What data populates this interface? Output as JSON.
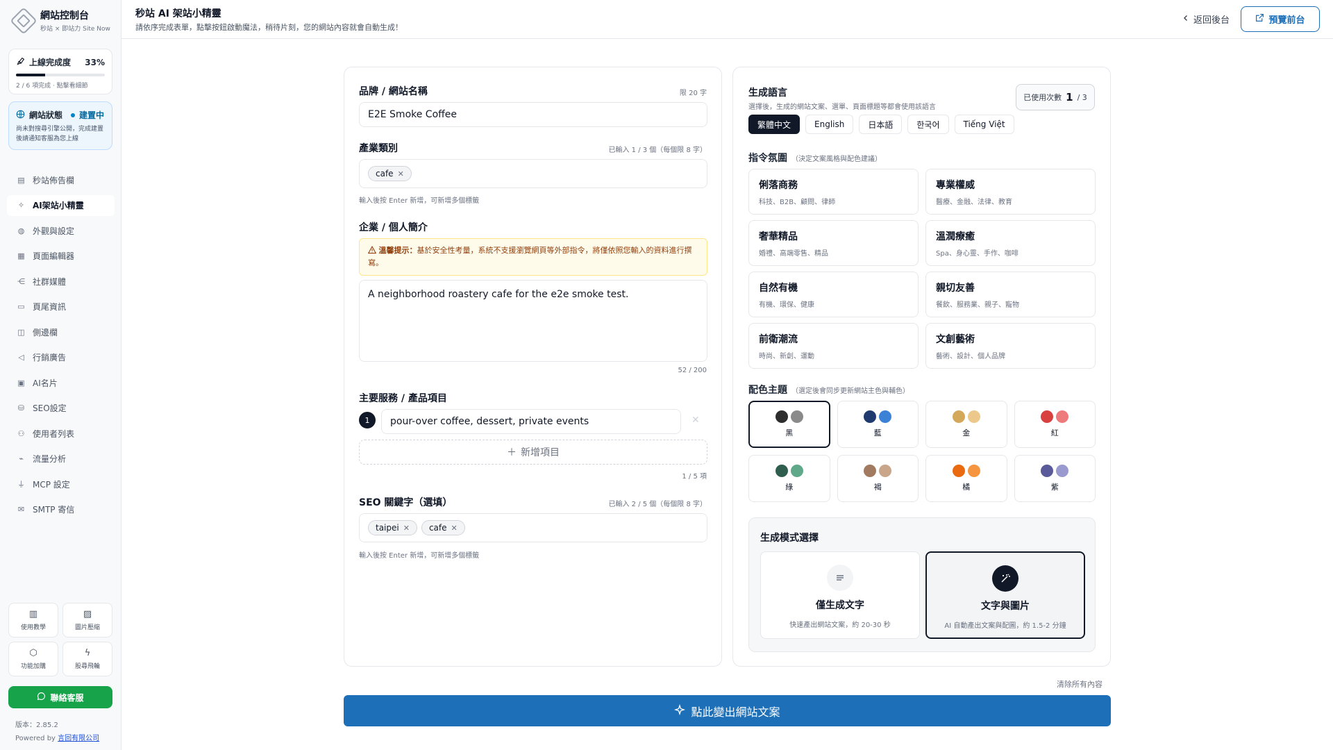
{
  "sidebar": {
    "brand": {
      "title": "網站控制台",
      "subtitle": "秒站 × 即站力 Site Now"
    },
    "progress": {
      "label": "上線完成度",
      "percent_text": "33%",
      "fraction": 0.33,
      "note": "2 / 6 項完成 · 點擊看細節"
    },
    "site_status": {
      "label": "網站狀態",
      "value": "建置中",
      "note": "尚未對搜尋引擎公開，完成建置後請通知客服為您上線"
    },
    "nav": [
      {
        "label": "秒站佈告欄",
        "icon": "bulletin-icon",
        "active": false
      },
      {
        "label": "AI架站小精靈",
        "icon": "sparkle-icon",
        "active": true
      },
      {
        "label": "外觀與設定",
        "icon": "palette-icon",
        "active": false
      },
      {
        "label": "頁面編輯器",
        "icon": "layout-icon",
        "active": false
      },
      {
        "label": "社群媒體",
        "icon": "share-icon",
        "active": false
      },
      {
        "label": "頁尾資訊",
        "icon": "footer-icon",
        "active": false
      },
      {
        "label": "側邊欄",
        "icon": "sidebar-icon",
        "active": false
      },
      {
        "label": "行銷廣告",
        "icon": "megaphone-icon",
        "active": false
      },
      {
        "label": "AI名片",
        "icon": "card-icon",
        "active": false
      },
      {
        "label": "SEO設定",
        "icon": "database-icon",
        "active": false
      },
      {
        "label": "使用者列表",
        "icon": "users-icon",
        "active": false
      },
      {
        "label": "流量分析",
        "icon": "chart-icon",
        "active": false
      },
      {
        "label": "MCP 設定",
        "icon": "plug-icon",
        "active": false
      },
      {
        "label": "SMTP 寄信",
        "icon": "mail-icon",
        "active": false
      }
    ],
    "tools": [
      {
        "label": "使用教學",
        "icon": "book-icon"
      },
      {
        "label": "圖片壓縮",
        "icon": "image-icon"
      },
      {
        "label": "功能加購",
        "icon": "package-icon"
      },
      {
        "label": "股尋飛輪",
        "icon": "bolt-icon"
      }
    ],
    "contact_label": "聯絡客服",
    "version": "版本：2.85.2",
    "powered_prefix": "Powered by ",
    "powered_link": "言回有限公司"
  },
  "header": {
    "title": "秒站 AI 架站小精靈",
    "subtitle": "請依序完成表單，點擊按鈕啟動魔法，稍待片刻，您的網站內容就會自動生成！",
    "back_label": "返回後台",
    "preview_label": "預覽前台"
  },
  "form": {
    "brand_name": {
      "label": "品牌 / 網站名稱",
      "hint": "限 20 字",
      "value": "E2E Smoke Coffee"
    },
    "industry": {
      "label": "產業類別",
      "hint": "已輸入 1 / 3 個（每個限 8 字）",
      "tags": [
        "cafe"
      ],
      "help": "輸入後按 Enter 新增，可新增多個標籤"
    },
    "intro": {
      "label": "企業 / 個人簡介",
      "warn_title": "溫馨提示：",
      "warn_text": "基於安全性考量，系統不支援瀏覽網頁等外部指令，將僅依照您輸入的資料進行撰寫。",
      "value": "A neighborhood roastery cafe for the e2e smoke test.",
      "count": "52 / 200"
    },
    "services": {
      "label": "主要服務 / 產品項目",
      "items": [
        {
          "num": "1",
          "value": "pour-over coffee, dessert, private events"
        }
      ],
      "add_label": "新增項目",
      "count": "1 / 5 項"
    },
    "seo": {
      "label": "SEO 關鍵字（選填）",
      "hint": "已輸入 2 / 5 個（每個限 8 字）",
      "tags": [
        "taipei",
        "cafe"
      ],
      "help": "輸入後按 Enter 新增，可新增多個標籤"
    }
  },
  "generation": {
    "language": {
      "label": "生成語言",
      "desc": "選擇後，生成的網站文案、選單、頁面標題等都會使用該語言",
      "options": [
        "繁體中文",
        "English",
        "日本語",
        "한국어",
        "Tiếng Việt"
      ],
      "selected": "繁體中文"
    },
    "usage": {
      "label": "已使用次數",
      "used": "1",
      "total": "/ 3"
    },
    "mood": {
      "label": "指令氛圍",
      "note": "（決定文案風格與配色建議）",
      "options": [
        {
          "title": "俐落商務",
          "desc": "科技、B2B、顧問、律師"
        },
        {
          "title": "專業權威",
          "desc": "醫療、金融、法律、教育"
        },
        {
          "title": "奢華精品",
          "desc": "婚禮、高端零售、精品"
        },
        {
          "title": "溫潤療癒",
          "desc": "Spa、身心靈、手作、咖啡"
        },
        {
          "title": "自然有機",
          "desc": "有機、環保、健康"
        },
        {
          "title": "親切友善",
          "desc": "餐飲、服務業、親子、寵物"
        },
        {
          "title": "前衛潮流",
          "desc": "時尚、新創、運動"
        },
        {
          "title": "文創藝術",
          "desc": "藝術、設計、個人品牌"
        }
      ]
    },
    "palette": {
      "label": "配色主題",
      "note": "（選定後會同步更新網站主色與輔色）",
      "selected": "黑",
      "options": [
        {
          "name": "黑",
          "c1": "#2d2d2d",
          "c2": "#8a8a8a"
        },
        {
          "name": "藍",
          "c1": "#1e3a6e",
          "c2": "#3b82d6"
        },
        {
          "name": "金",
          "c1": "#d4a85a",
          "c2": "#ecc98a"
        },
        {
          "name": "紅",
          "c1": "#d94040",
          "c2": "#ee7b7b"
        },
        {
          "name": "綠",
          "c1": "#2f5e4e",
          "c2": "#5fa88a"
        },
        {
          "name": "褐",
          "c1": "#a17a60",
          "c2": "#c9a58a"
        },
        {
          "name": "橘",
          "c1": "#ea6a10",
          "c2": "#f59540"
        },
        {
          "name": "紫",
          "c1": "#5a5a9a",
          "c2": "#9a9ad0"
        }
      ]
    },
    "mode": {
      "label": "生成模式選擇",
      "selected": "文字與圖片",
      "options": [
        {
          "title": "僅生成文字",
          "desc": "快速產出網站文案，約 20-30 秒",
          "icon": "text-lines-icon"
        },
        {
          "title": "文字與圖片",
          "desc": "AI 自動產出文案與配圖，約 1.5-2 分鐘",
          "icon": "magic-wand-icon"
        }
      ]
    }
  },
  "actions": {
    "clear_label": "清除所有內容",
    "generate_label": "點此變出網站文案"
  },
  "colors": {
    "primary": "#1d6fb8",
    "dark": "#111827",
    "success": "#16a34a",
    "warn_bg": "#fffbeb"
  }
}
